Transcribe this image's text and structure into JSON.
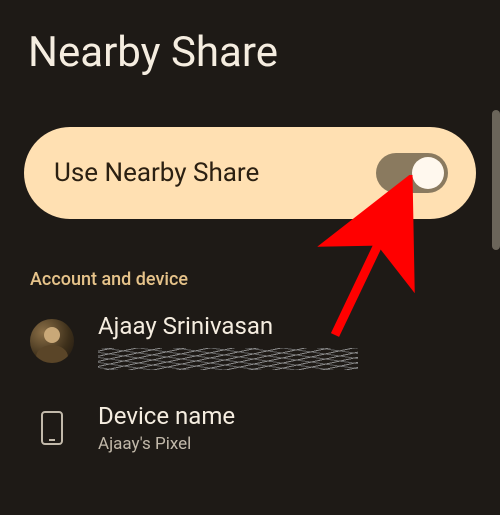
{
  "header": {
    "title": "Nearby Share"
  },
  "toggle": {
    "label": "Use Nearby Share",
    "enabled": true
  },
  "section": {
    "header": "Account and device"
  },
  "account": {
    "name": "Ajaay Srinivasan"
  },
  "device": {
    "label": "Device name",
    "value": "Ajaay's Pixel"
  }
}
